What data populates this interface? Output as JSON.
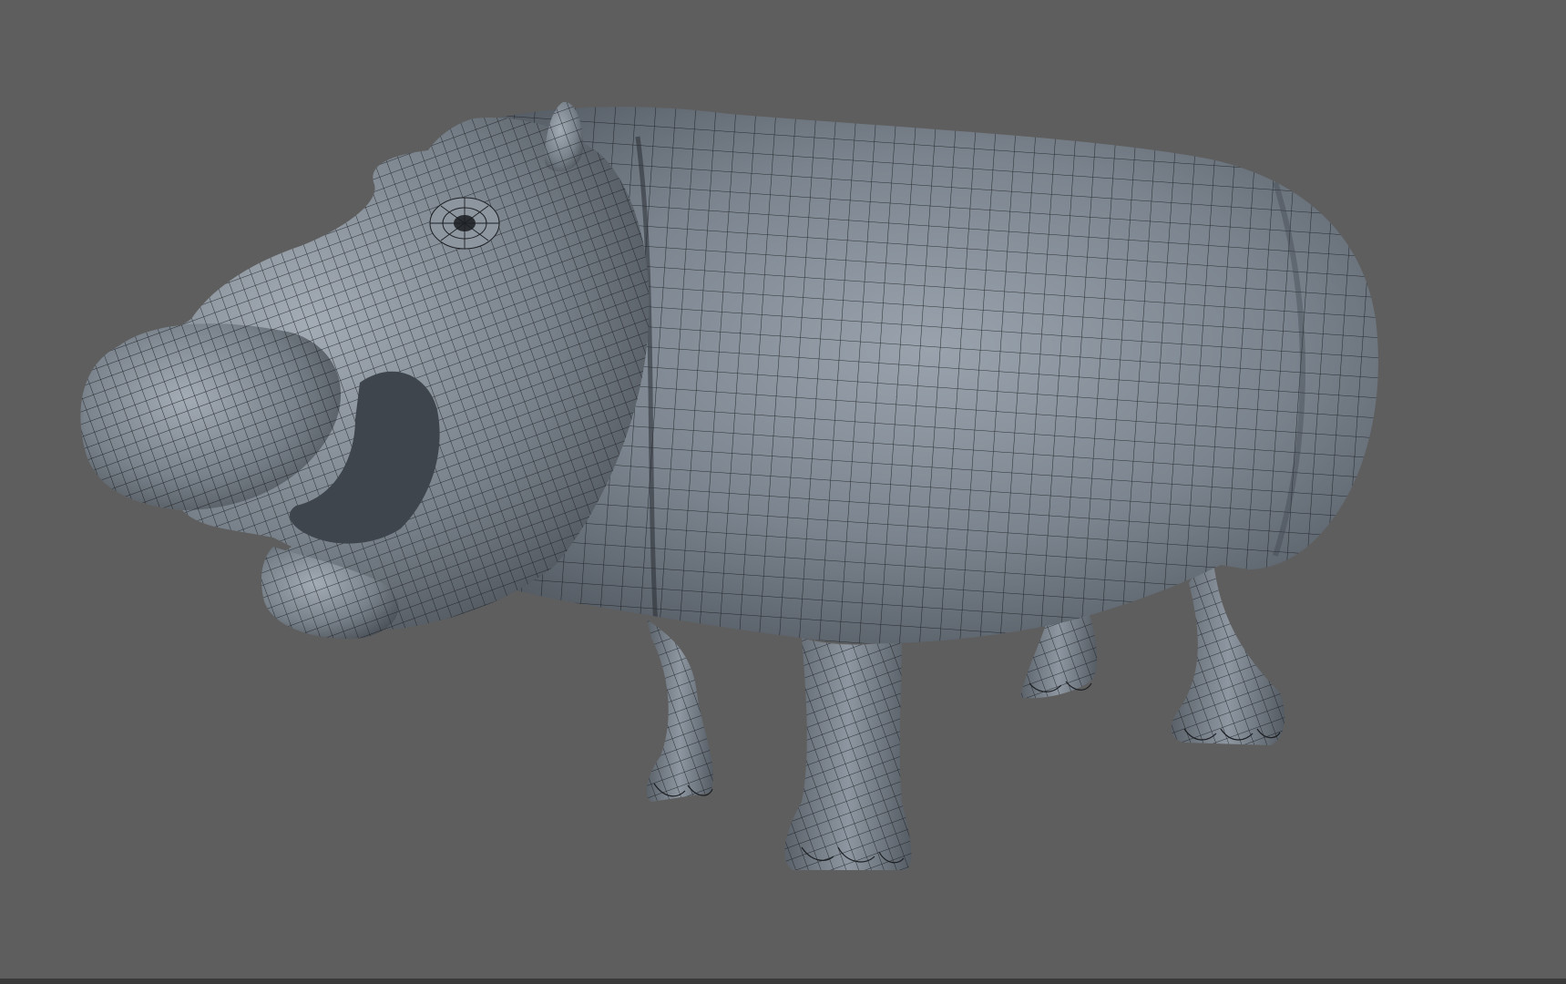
{
  "viewport": {
    "background_color": "#5e5e5e",
    "mesh_color": "#7f8892",
    "wire_color": "#1c1f23",
    "mode": "wireframe-on-shaded"
  },
  "model": {
    "icon": "hippo-model-icon"
  }
}
